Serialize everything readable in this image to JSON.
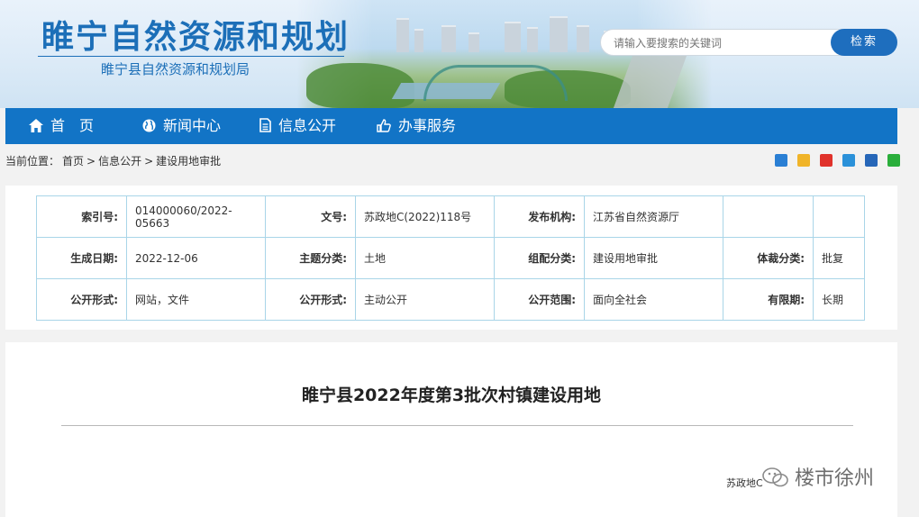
{
  "header": {
    "site_title": "睢宁自然资源和规划",
    "site_subtitle": "睢宁县自然资源和规划局",
    "search": {
      "placeholder": "请输入要搜索的关键词",
      "button": "检索"
    }
  },
  "nav": [
    {
      "label": "首　页",
      "icon": "home-icon"
    },
    {
      "label": "新闻中心",
      "icon": "globe-icon"
    },
    {
      "label": "信息公开",
      "icon": "document-icon"
    },
    {
      "label": "办事服务",
      "icon": "thumbs-up-icon"
    }
  ],
  "breadcrumb": [
    "当前位置：",
    "首页",
    ">",
    "信息公开",
    ">",
    "建设用地审批"
  ],
  "meta": {
    "rows": [
      [
        {
          "label": "索引号:",
          "value": "014000060/2022-05663"
        },
        {
          "label": "文号:",
          "value": "苏政地C(2022)118号"
        },
        {
          "label": "发布机构:",
          "value": "江苏省自然资源厅"
        },
        {
          "label": "",
          "value": ""
        }
      ],
      [
        {
          "label": "生成日期:",
          "value": "2022-12-06"
        },
        {
          "label": "主题分类:",
          "value": "土地"
        },
        {
          "label": "组配分类:",
          "value": "建设用地审批"
        },
        {
          "label": "体裁分类:",
          "value": "批复"
        }
      ],
      [
        {
          "label": "公开形式:",
          "value": "网站，文件"
        },
        {
          "label": "公开形式:",
          "value": "主动公开"
        },
        {
          "label": "公开范围:",
          "value": "面向全社会"
        },
        {
          "label": "有限期:",
          "value": "长期"
        }
      ]
    ]
  },
  "article": {
    "title": "睢宁县2022年度第3批次村镇建设用地",
    "doc_number": "苏政地C",
    "watermark": "楼市徐州"
  },
  "colors": {
    "brand": "#1274c6",
    "label": "#1c6fb8",
    "table_border": "#a9d5e8"
  }
}
